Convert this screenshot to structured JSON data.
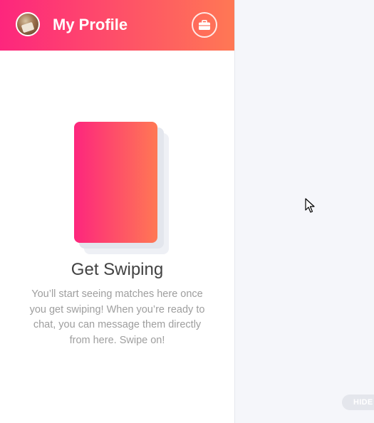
{
  "header": {
    "title": "My Profile",
    "avatar_icon": "user-avatar",
    "work_icon": "briefcase-icon"
  },
  "empty_state": {
    "title": "Get Swiping",
    "description": "You’ll start seeing matches here once you get swiping! When you’re ready to chat, you can message them directly from here. Swipe on!"
  },
  "hide_button": {
    "label": "HIDE"
  },
  "colors": {
    "brand_gradient_start": "#fd267d",
    "brand_gradient_end": "#ff7854",
    "main_background": "#f5f6fa"
  }
}
